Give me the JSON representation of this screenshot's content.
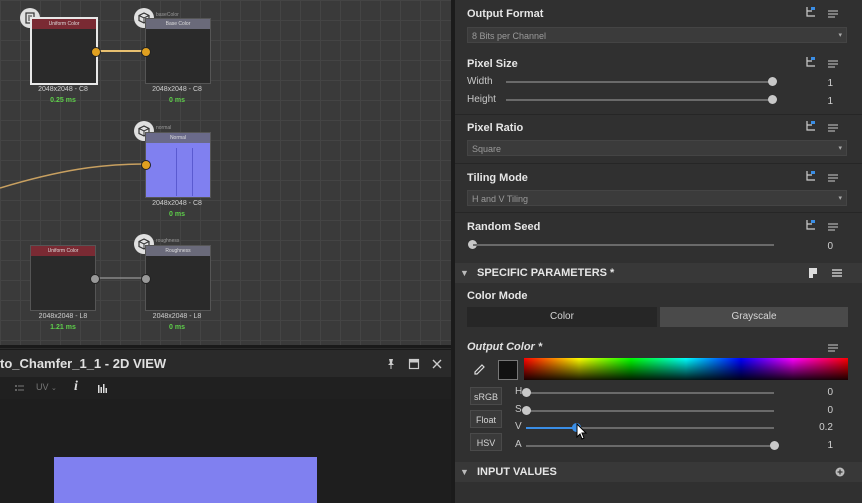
{
  "graph": {
    "nodes": [
      {
        "title": "Uniform Color",
        "size": "2048x2048 - C8",
        "time": "0.25 ms"
      },
      {
        "title": "Base Color",
        "size": "2048x2048 - C8",
        "time": "0 ms",
        "id": "baseColor"
      },
      {
        "title": "Normal",
        "size": "2048x2048 - C8",
        "time": "0 ms",
        "id": "normal"
      },
      {
        "title": "Uniform Color",
        "size": "2048x2048 - L8",
        "time": "1.21 ms"
      },
      {
        "title": "Roughness",
        "size": "2048x2048 - L8",
        "time": "0 ms",
        "id": "roughness"
      }
    ]
  },
  "view2d": {
    "title": "to_Chamfer_1_1 - 2D VIEW",
    "uv_label": "UV",
    "info_icon": "i"
  },
  "panel": {
    "output_format": {
      "label": "Output Format",
      "value": "8 Bits per Channel"
    },
    "pixel_size": {
      "label": "Pixel Size",
      "width_label": "Width",
      "width_value": "1",
      "height_label": "Height",
      "height_value": "1"
    },
    "pixel_ratio": {
      "label": "Pixel Ratio",
      "value": "Square"
    },
    "tiling_mode": {
      "label": "Tiling Mode",
      "value": "H and V Tiling"
    },
    "random_seed": {
      "label": "Random Seed",
      "value": "0"
    },
    "specific": {
      "label": "SPECIFIC PARAMETERS *"
    },
    "color_mode": {
      "label": "Color Mode",
      "options": [
        "Color",
        "Grayscale"
      ],
      "selected": "Color"
    },
    "output_color": {
      "label": "Output Color *",
      "modes": [
        "sRGB",
        "Float",
        "HSV"
      ],
      "channels": [
        {
          "label": "H",
          "value": "0",
          "level": 0
        },
        {
          "label": "S",
          "value": "0",
          "level": 0
        },
        {
          "label": "V",
          "value": "0.2",
          "level": 0.2
        },
        {
          "label": "A",
          "value": "1",
          "level": 1
        }
      ]
    },
    "input_values": {
      "label": "INPUT VALUES"
    }
  },
  "colors": {
    "accent": "#3a8ee6",
    "time_green": "#5ecf4a",
    "normal_map": "#8080f0"
  },
  "icons": [
    "document-icon",
    "cube-icon",
    "pin-icon",
    "maximize-icon",
    "close-icon",
    "histogram-icon",
    "eyedropper-icon",
    "link-icon",
    "menu-icon"
  ]
}
